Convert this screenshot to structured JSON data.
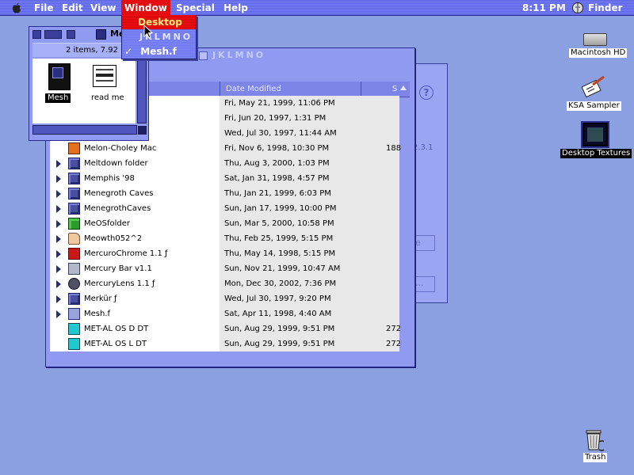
{
  "menubar": {
    "items": [
      "File",
      "Edit",
      "View",
      "Window",
      "Special",
      "Help"
    ],
    "clock": "8:11 PM",
    "app": "Finder"
  },
  "window_menu": {
    "items": [
      "Desktop",
      "JKLMNO",
      "Mesh.f"
    ],
    "checked": "✓"
  },
  "mesh_window": {
    "title": "Mesh.f",
    "info": "2 items, 7.92",
    "files": [
      "Mesh",
      "read me"
    ]
  },
  "list_window": {
    "title": "JKLMNO",
    "columns": {
      "date": "Date Modified",
      "size": "S"
    },
    "rows": [
      {
        "name": "",
        "date": "Fri, May 21, 1999, 11:06 PM",
        "size": "",
        "icon": "folder-icon",
        "disclose": false
      },
      {
        "name": "",
        "date": "Fri, Jun 20, 1997, 1:31 PM",
        "size": "",
        "icon": "folder-icon",
        "disclose": false
      },
      {
        "name": "",
        "date": "Wed, Jul 30, 1997, 11:44 AM",
        "size": "",
        "icon": "folder-icon",
        "disclose": false
      },
      {
        "name": "Melon-Choley Mac",
        "date": "Fri, Nov 6, 1998, 10:30 PM",
        "size": "188",
        "icon": "app-icon",
        "disclose": false
      },
      {
        "name": "Meltdown folder",
        "date": "Thu, Aug 3, 2000, 1:03 PM",
        "size": "",
        "icon": "folder-icon",
        "disclose": true
      },
      {
        "name": "Memphis '98",
        "date": "Sat, Jan 31, 1998, 4:57 PM",
        "size": "",
        "icon": "folder-icon",
        "disclose": true
      },
      {
        "name": "Menegroth Caves",
        "date": "Thu, Jan 21, 1999, 6:03 PM",
        "size": "",
        "icon": "folder-icon",
        "disclose": true
      },
      {
        "name": "MenegrothCaves",
        "date": "Sun, Jan 17, 1999, 10:00 PM",
        "size": "",
        "icon": "folder-icon",
        "disclose": true
      },
      {
        "name": "MeOSfolder",
        "date": "Sun, Mar 5, 2000, 10:58 PM",
        "size": "",
        "icon": "green-folder-icon",
        "disclose": true
      },
      {
        "name": "Meowth052^2",
        "date": "Thu, Feb 25, 1999, 5:15 PM",
        "size": "",
        "icon": "peach-folder-icon",
        "disclose": true
      },
      {
        "name": "MercuroChrome 1.1 ƒ",
        "date": "Thu, May 14, 1998, 5:15 PM",
        "size": "",
        "icon": "red-folder-icon",
        "disclose": true
      },
      {
        "name": "Mercury Bar v1.1",
        "date": "Sun, Nov 21, 1999, 10:47 AM",
        "size": "",
        "icon": "gray-folder-icon",
        "disclose": true
      },
      {
        "name": "MercuryLens 1.1 ƒ",
        "date": "Mon, Dec 30, 2002, 7:36 PM",
        "size": "",
        "icon": "lens-icon",
        "disclose": true
      },
      {
        "name": "Merkür ƒ",
        "date": "Wed, Jul 30, 1997, 9:20 PM",
        "size": "",
        "icon": "folder-icon",
        "disclose": true
      },
      {
        "name": "Mesh.f",
        "date": "Sat, Apr 11, 1998, 4:40 AM",
        "size": "",
        "icon": "mesh-folder-icon",
        "disclose": true
      },
      {
        "name": "MET-AL OS D DT",
        "date": "Sun, Aug 29, 1999, 9:51 PM",
        "size": "272",
        "icon": "theme-icon",
        "disclose": false
      },
      {
        "name": "MET-AL OS L DT",
        "date": "Sun, Aug 29, 1999, 9:51 PM",
        "size": "272",
        "icon": "theme-icon",
        "disclose": false
      }
    ]
  },
  "back_window": {
    "help": "?",
    "version": "2.3.1",
    "field1": "e",
    "field2": "..."
  },
  "desktop": {
    "icons": [
      "Macintosh HD",
      "KSA Sampler",
      "Desktop Textures",
      "Trash"
    ]
  }
}
